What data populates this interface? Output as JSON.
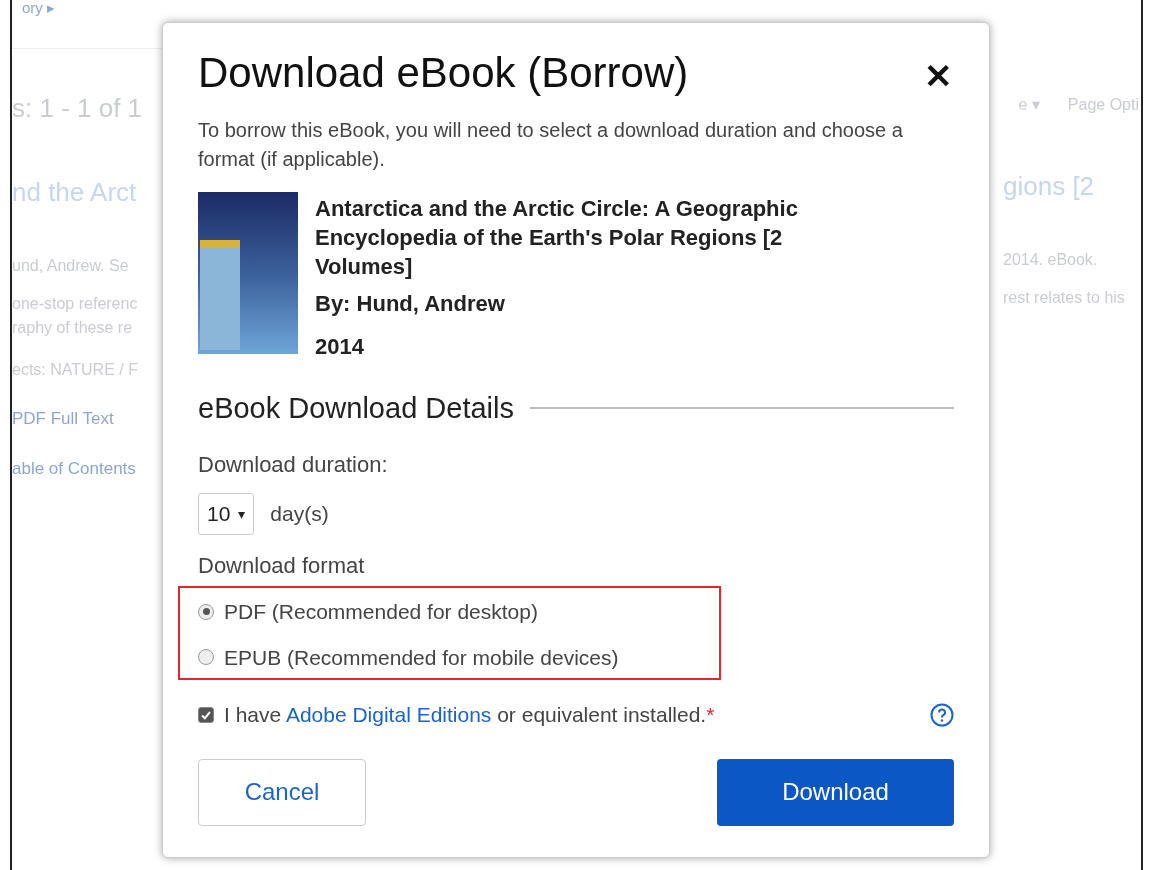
{
  "background_page": {
    "breadcrumb": "ory ▸",
    "results_heading": "s: 1 - 1 of 1",
    "sort_menu": "e ▾",
    "page_options": "Page Opti",
    "result": {
      "title_left": "nd the Arct",
      "title_right": "gions [2",
      "citation_left": "und, Andrew. Se",
      "citation_right": "2014. eBook.",
      "abstract_left": [
        "one-stop referenc",
        "raphy of these re"
      ],
      "abstract_right": "rest relates to his",
      "subjects": "ects: NATURE / F",
      "links": [
        "PDF Full Text",
        "able of Contents"
      ]
    }
  },
  "dialog": {
    "title": "Download eBook (Borrow)",
    "close": "✕",
    "intro": "To borrow this eBook, you will need to select a download duration and choose a format (if applicable).",
    "book": {
      "title": "Antarctica and the Arctic Circle: A Geographic Encyclopedia of the Earth's Polar Regions [2 Volumes]",
      "author": "By: Hund, Andrew",
      "year": "2014"
    },
    "section_heading": "eBook Download Details",
    "duration": {
      "label": "Download duration:",
      "value": "10",
      "caret": "▾",
      "unit": "day(s)"
    },
    "format": {
      "label": "Download format",
      "options": [
        {
          "label": "PDF (Recommended for desktop)",
          "selected": true
        },
        {
          "label": "EPUB (Recommended for mobile devices)",
          "selected": false
        }
      ]
    },
    "acknowledgement": {
      "checked": true,
      "prefix": "I have ",
      "link": "Adobe Digital Editions",
      "suffix": " or equivalent installed.",
      "required_mark": "*"
    },
    "buttons": {
      "cancel": "Cancel",
      "download": "Download"
    }
  }
}
